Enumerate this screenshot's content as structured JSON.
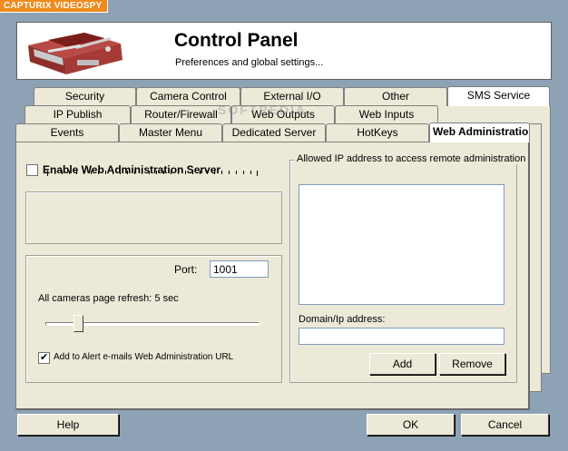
{
  "app_tag": "CAPTURIX VIDEOSPY",
  "header": {
    "title": "Control Panel",
    "subtitle": "Preferences and global settings..."
  },
  "watermark": "SOFTPEDIA",
  "tabs": {
    "row1": [
      "Security",
      "Camera Control",
      "External I/O",
      "Other",
      "SMS Service"
    ],
    "row2": [
      "IP Publish",
      "Router/Firewall",
      "Web Outputs",
      "Web Inputs"
    ],
    "row3": [
      "Events",
      "Master Menu",
      "Dedicated Server",
      "HotKeys",
      "Web Administration"
    ]
  },
  "web_admin": {
    "enable_label": "Enable Web Administration Server",
    "enable_checked": false,
    "port_label": "Port:",
    "port_value": "1001",
    "refresh_label": "All cameras page refresh: 5 sec",
    "refresh_value_sec": 5,
    "alert_label": "Add to Alert e-mails Web Administration URL",
    "alert_checked": true,
    "allowed_group_label": "Allowed IP address to access remote administration",
    "allowed_list": [],
    "domain_label": "Domain/Ip address:",
    "domain_value": "",
    "add_label": "Add",
    "remove_label": "Remove"
  },
  "footer": {
    "help_label": "Help",
    "ok_label": "OK",
    "cancel_label": "Cancel"
  },
  "colors": {
    "background": "#8ea2b6",
    "panel": "#ece9d8",
    "app_tag": "#f08a1c"
  }
}
